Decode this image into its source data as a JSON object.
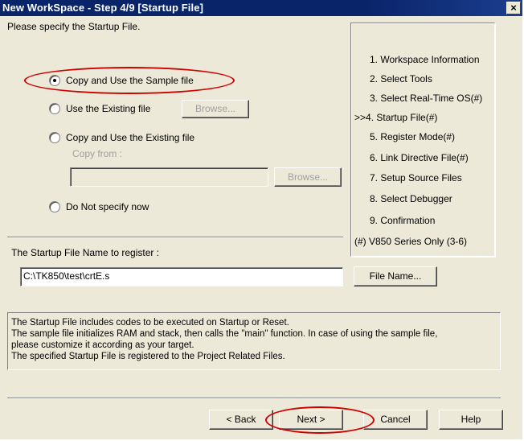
{
  "window": {
    "title": "New WorkSpace - Step 4/9 [Startup File]",
    "close_symbol": "×"
  },
  "instruction": "Please specify the Startup File.",
  "options": {
    "copy_sample": "Copy and Use the Sample file",
    "use_existing": "Use the Existing file",
    "copy_existing": "Copy and Use the Existing file",
    "copy_from_label": "Copy from :",
    "copy_from_value": "",
    "do_not_specify": "Do Not specify now",
    "selected": "copy_sample"
  },
  "browse_label": "Browse...",
  "startup_name": {
    "label": "The Startup File Name to register :",
    "value": "C:\\TK850\\test\\crtE.s",
    "button": "File Name..."
  },
  "steps": {
    "items": [
      "1. Workspace Information",
      "2. Select Tools",
      "3. Select Real-Time OS(#)",
      ">>4. Startup File(#)",
      "5. Register Mode(#)",
      "6. Link Directive File(#)",
      "7. Setup Source Files",
      "8. Select Debugger",
      "9. Confirmation"
    ],
    "footnote": "(#) V850 Series Only (3-6)"
  },
  "description": [
    "The Startup File includes codes to be executed on Startup or Reset.",
    "The sample file initializes RAM and stack, then calls the \"main\" function. In case of using the sample file,",
    "please customize it according as your target.",
    "The specified Startup File is registered to the Project Related Files."
  ],
  "buttons": {
    "back": "< Back",
    "next": "Next >",
    "cancel": "Cancel",
    "help": "Help"
  },
  "annotation_color": "#d10000"
}
